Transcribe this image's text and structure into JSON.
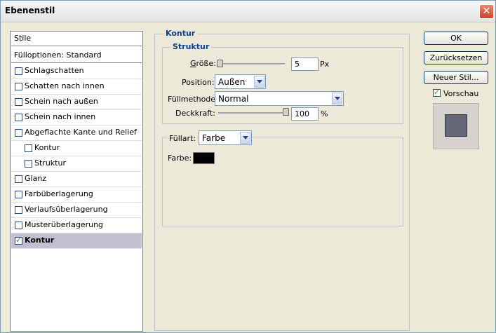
{
  "window": {
    "title": "Ebenenstil",
    "close_label": "✕"
  },
  "styles_list": {
    "header": "Stile",
    "blending_options": "Fülloptionen: Standard",
    "items": [
      {
        "label": "Schlagschatten",
        "checked": false,
        "indent": 0
      },
      {
        "label": "Schatten nach innen",
        "checked": false,
        "indent": 0
      },
      {
        "label": "Schein nach außen",
        "checked": false,
        "indent": 0
      },
      {
        "label": "Schein nach innen",
        "checked": false,
        "indent": 0
      },
      {
        "label": "Abgeflachte Kante und Relief",
        "checked": false,
        "indent": 0
      },
      {
        "label": "Kontur",
        "checked": false,
        "indent": 1
      },
      {
        "label": "Struktur",
        "checked": false,
        "indent": 1
      },
      {
        "label": "Glanz",
        "checked": false,
        "indent": 0
      },
      {
        "label": "Farbüberlagerung",
        "checked": false,
        "indent": 0
      },
      {
        "label": "Verlaufsüberlagerung",
        "checked": false,
        "indent": 0
      },
      {
        "label": "Musterüberlagerung",
        "checked": false,
        "indent": 0
      },
      {
        "label": "Kontur",
        "checked": true,
        "indent": 0,
        "selected": true
      }
    ]
  },
  "panel": {
    "title": "Kontur",
    "structure": {
      "title": "Struktur",
      "size_label": "Größe:",
      "size_value": "5",
      "size_unit": "Px",
      "size_slider_fraction": 0.02,
      "position_label": "Position:",
      "position_value": "Außen",
      "blend_mode_label": "Füllmethode:",
      "blend_mode_value": "Normal",
      "opacity_label": "Deckkraft:",
      "opacity_value": "100",
      "opacity_unit": "%",
      "opacity_slider_fraction": 1.0
    },
    "fill": {
      "fill_type_label": "Füllart:",
      "fill_type_value": "Farbe",
      "color_label": "Farbe:",
      "color": "#000000"
    }
  },
  "buttons": {
    "ok": "OK",
    "reset": "Zurücksetzen",
    "new_style": "Neuer Stil...",
    "preview_label": "Vorschau",
    "preview_checked": true
  },
  "colors": {
    "accent": "#0e3d8c",
    "selection": "#c2c0d0",
    "preview_swatch": "#656777"
  }
}
